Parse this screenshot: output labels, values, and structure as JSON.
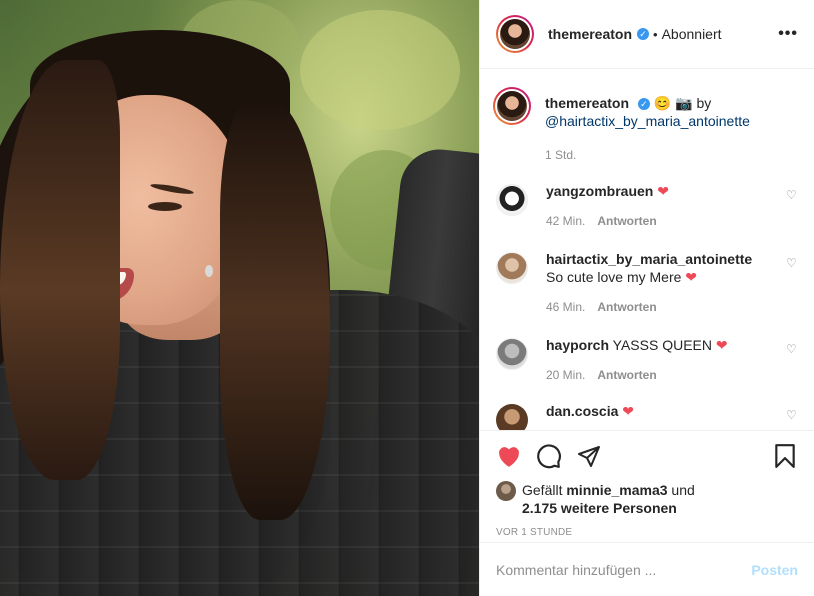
{
  "colors": {
    "accent_blue": "#3897f0",
    "like_red": "#ed4956",
    "post_disabled": "#b2dffc",
    "muted_text": "#8e8e8e"
  },
  "header": {
    "username": "themereaton",
    "separator": "•",
    "follow_status": "Abonniert",
    "more_icon": "ellipsis-icon",
    "more_label": "•••"
  },
  "caption": {
    "username": "themereaton",
    "emoji1": "😊",
    "emoji2": "📷",
    "by": "by",
    "mention": "@hairtactix_by_maria_antoinette",
    "time": "1 Std."
  },
  "comments": [
    {
      "username": "yangzombrauen",
      "text": "",
      "heart": "❤",
      "time": "42 Min.",
      "reply": "Antworten"
    },
    {
      "username": "hairtactix_by_maria_antoinette",
      "text": "So cute love my Mere",
      "heart": "❤",
      "time": "46 Min.",
      "reply": "Antworten"
    },
    {
      "username": "hayporch",
      "text": "YASSS QUEEN",
      "heart": "❤",
      "time": "20 Min.",
      "reply": "Antworten"
    },
    {
      "username": "dan.coscia",
      "text": "",
      "heart": "❤",
      "time": "",
      "reply": ""
    }
  ],
  "actions": {
    "like_icon": "heart-filled-icon",
    "comment_icon": "comment-bubble-icon",
    "share_icon": "paper-plane-icon",
    "save_icon": "bookmark-icon"
  },
  "likes": {
    "prefix": "Gefällt",
    "user": "minnie_mama3",
    "and": "und",
    "others": "2.175 weitere Personen"
  },
  "timestamp": "VOR 1 STUNDE",
  "add_comment": {
    "placeholder": "Kommentar hinzufügen ...",
    "post_label": "Posten"
  }
}
